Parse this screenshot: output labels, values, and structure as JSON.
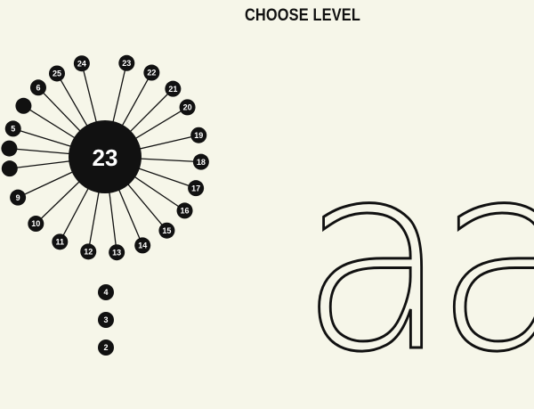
{
  "header": {
    "title": "CHOOSE LEVEL"
  },
  "logo": {
    "text": "aa"
  },
  "wheel": {
    "center_label": "23",
    "pins": [
      {
        "label": "5",
        "angle": 197
      },
      {
        "label": "6",
        "angle": 226
      },
      {
        "label": "25",
        "angle": 240
      },
      {
        "label": "24",
        "angle": 256
      },
      {
        "label": "23",
        "angle": 283
      },
      {
        "label": "22",
        "angle": 299
      },
      {
        "label": "21",
        "angle": 315
      },
      {
        "label": "20",
        "angle": 329
      },
      {
        "label": "19",
        "angle": 347
      },
      {
        "label": "18",
        "angle": 3
      },
      {
        "label": "17",
        "angle": 19
      },
      {
        "label": "16",
        "angle": 34
      },
      {
        "label": "15",
        "angle": 50
      },
      {
        "label": "14",
        "angle": 67
      },
      {
        "label": "13",
        "angle": 83
      },
      {
        "label": "12",
        "angle": 100
      },
      {
        "label": "11",
        "angle": 118
      },
      {
        "label": "10",
        "angle": 136
      },
      {
        "label": "9",
        "angle": 155
      },
      {
        "label": "",
        "angle": 173
      },
      {
        "label": "",
        "angle": 185
      },
      {
        "label": "",
        "angle": 212
      }
    ]
  },
  "queue": [
    "4",
    "3",
    "2"
  ],
  "colors": {
    "background": "#f6f6e9",
    "ink": "#111111",
    "pin_text": "#ffffff"
  }
}
